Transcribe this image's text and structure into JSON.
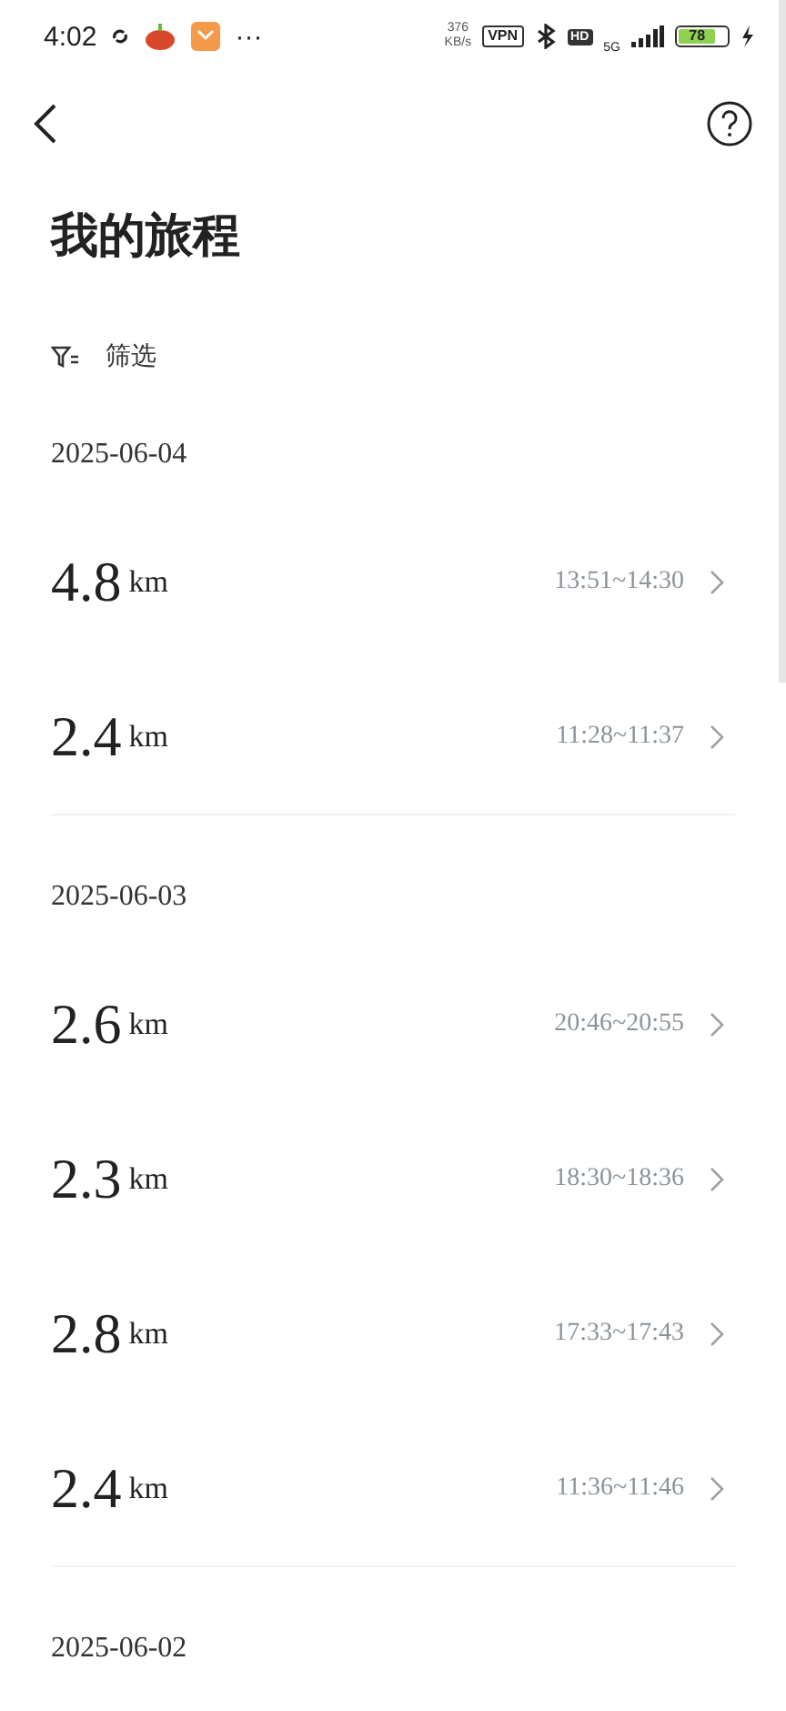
{
  "status_bar": {
    "time": "4:02",
    "more": "···",
    "net_speed": "376",
    "net_unit": "KB/s",
    "vpn": "VPN",
    "hd": "HD",
    "network": "5G",
    "battery": "78"
  },
  "header": {
    "title": "我的旅程"
  },
  "filter": {
    "label": "筛选"
  },
  "days": [
    {
      "date": "2025-06-04",
      "trips": [
        {
          "distance": "4.8",
          "unit": "km",
          "time": "13:51~14:30"
        },
        {
          "distance": "2.4",
          "unit": "km",
          "time": "11:28~11:37"
        }
      ]
    },
    {
      "date": "2025-06-03",
      "trips": [
        {
          "distance": "2.6",
          "unit": "km",
          "time": "20:46~20:55"
        },
        {
          "distance": "2.3",
          "unit": "km",
          "time": "18:30~18:36"
        },
        {
          "distance": "2.8",
          "unit": "km",
          "time": "17:33~17:43"
        },
        {
          "distance": "2.4",
          "unit": "km",
          "time": "11:36~11:46"
        }
      ]
    },
    {
      "date": "2025-06-02"
    }
  ]
}
